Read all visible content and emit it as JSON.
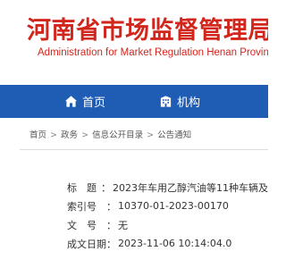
{
  "header": {
    "title_cn": "河南省市场监督管理局",
    "title_en": "Administration for Market Regulation Henan Province"
  },
  "nav": {
    "items": [
      {
        "label": "首页",
        "icon": "home-icon"
      },
      {
        "label": "机构",
        "icon": "building-icon"
      }
    ],
    "color": "#1f5db4"
  },
  "breadcrumb": {
    "items": [
      "首页",
      "政务",
      "信息公开目录",
      "公告通知"
    ],
    "separator": ">"
  },
  "meta": {
    "title_label": "标　题",
    "title_value": "2023年车用乙醇汽油等11种车辆及",
    "index_label": "索引号",
    "index_value": "10370-01-2023-00170",
    "doc_label": "文　号",
    "doc_value": "无",
    "date_label": "成文日期",
    "date_value": "2023-11-06 10:14:04.0"
  },
  "colors": {
    "brand_red": "#d2261c",
    "nav_blue": "#1f5db4"
  }
}
